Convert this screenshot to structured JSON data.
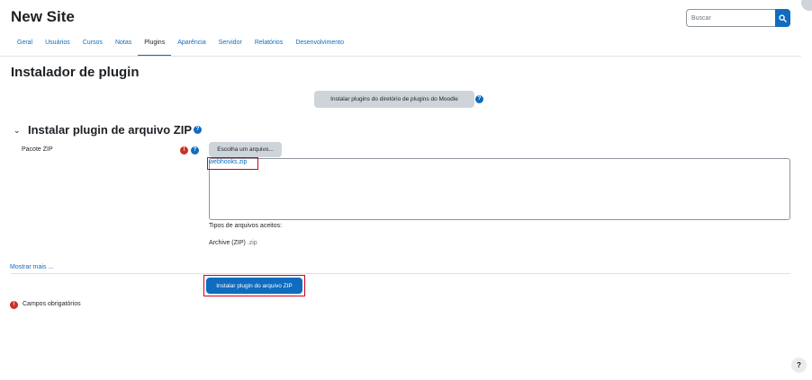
{
  "site": {
    "title": "New Site"
  },
  "search": {
    "placeholder": "Buscar",
    "button_icon": "search-icon"
  },
  "nav": {
    "tabs": [
      {
        "label": "Geral",
        "active": false
      },
      {
        "label": "Usuários",
        "active": false
      },
      {
        "label": "Cursos",
        "active": false
      },
      {
        "label": "Notas",
        "active": false
      },
      {
        "label": "Plugins",
        "active": true
      },
      {
        "label": "Aparência",
        "active": false
      },
      {
        "label": "Servidor",
        "active": false
      },
      {
        "label": "Relatórios",
        "active": false
      },
      {
        "label": "Desenvolvimento",
        "active": false
      }
    ]
  },
  "page": {
    "heading": "Instalador de plugin",
    "directory_button": "Instalar plugins do diretório de plugins do Moodle",
    "help_glyph": "?",
    "required_glyph": "!"
  },
  "zip_section": {
    "chevron": "⌄",
    "title": "Instalar plugin de arquivo ZIP",
    "field_label": "Pacote ZIP",
    "choose_button": "Escolha um arquivo...",
    "selected_file": "webhooks.zip",
    "accepted_title": "Tipos de arquivos aceitos:",
    "accepted_type": "Archive (ZIP)",
    "accepted_ext": ".zip",
    "show_more": "Mostrar mais ...",
    "submit_button": "Instalar plugin do arquivo ZIP",
    "required_note": "Campos obrigatórios"
  },
  "colors": {
    "primary": "#0f6cbf",
    "danger": "#ca3120",
    "secondary_button": "#ced4da",
    "highlight": "#d0021b"
  }
}
